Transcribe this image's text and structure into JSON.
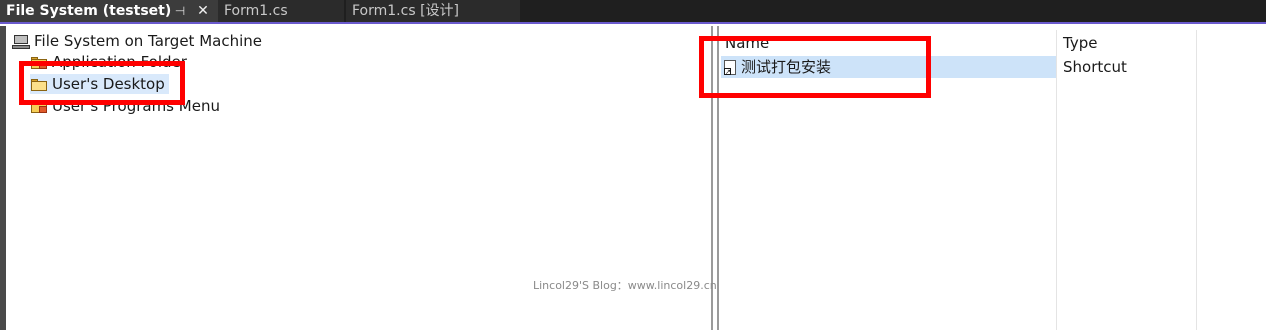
{
  "tabs": [
    {
      "label": "File System (testset)",
      "active": true
    },
    {
      "label": "Form1.cs",
      "active": false
    },
    {
      "label": "Form1.cs [设计]",
      "active": false
    }
  ],
  "tab_icons": {
    "pin": "pin-icon",
    "close": "close-icon"
  },
  "tree": {
    "root": {
      "label": "File System on Target Machine",
      "icon": "computer-icon"
    },
    "children": [
      {
        "label": "Application Folder",
        "icon": "folder-icon",
        "selected": false
      },
      {
        "label": "User's Desktop",
        "icon": "folder-open-icon",
        "selected": true
      },
      {
        "label": "User's Programs Menu",
        "icon": "folder-icon",
        "selected": false
      }
    ]
  },
  "list": {
    "columns": [
      "Name",
      "Type"
    ],
    "rows": [
      {
        "name": "测试打包安装",
        "type": "Shortcut",
        "icon": "shortcut-icon",
        "selected": true
      }
    ]
  },
  "watermark": "Lincol29'S Blog：www.lincol29.cn",
  "colors": {
    "annotation": "#ff0000",
    "selection": "#cde3f9",
    "tab_bar": "#1f1f1f",
    "tab_accent": "#6a5acd"
  }
}
